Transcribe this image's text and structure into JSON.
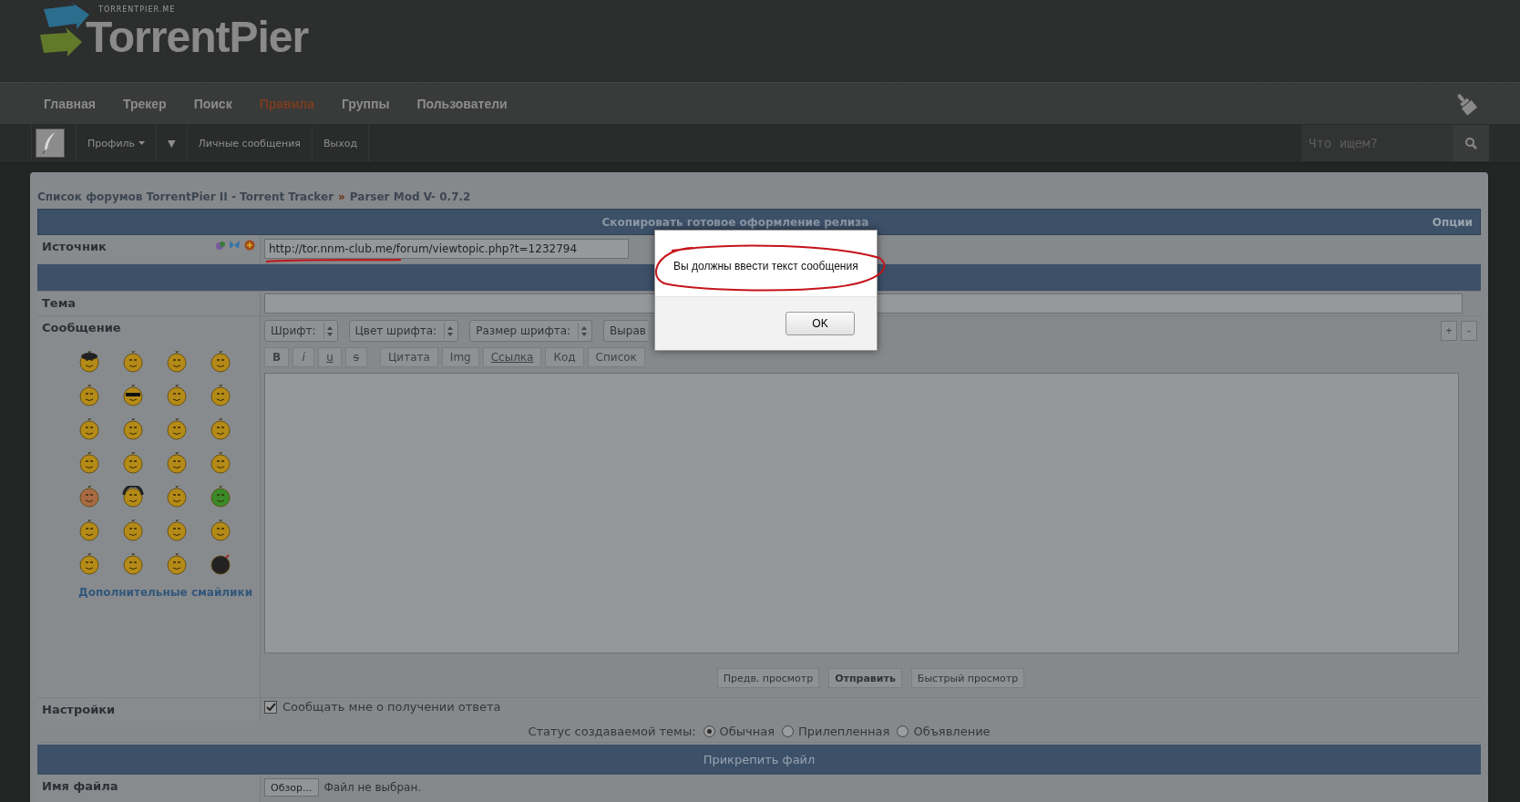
{
  "logo": {
    "title": "TorrentPier",
    "subtitle": "TORRENTPIER.ME"
  },
  "nav": [
    {
      "label": "Главная",
      "selected": false
    },
    {
      "label": "Трекер",
      "selected": false
    },
    {
      "label": "Поиск",
      "selected": false
    },
    {
      "label": "Правила",
      "selected": true
    },
    {
      "label": "Группы",
      "selected": false
    },
    {
      "label": "Пользователи",
      "selected": false
    }
  ],
  "userbar": {
    "profile": "Профиль",
    "more": "▼",
    "links": [
      "Личные сообщения",
      "Выход"
    ],
    "search": {
      "placeholder": "Что ищем?"
    }
  },
  "breadcrumb": {
    "items": [
      "Список форумов TorrentPier II - Torrent Tracker",
      "Parser Mod V- 0.7.2"
    ],
    "separator": "»"
  },
  "form": {
    "title": "Скопировать готовое оформление релиза",
    "options": "Опции",
    "source": {
      "label": "Источник",
      "value": "http://tor.nnm-club.me/forum/viewtopic.php?t=1232794"
    },
    "subject": {
      "label": "Тема"
    },
    "message": {
      "label": "Сообщение",
      "selects": [
        {
          "label": "Шрифт:",
          "cut": false
        },
        {
          "label": "Цвет шрифта:",
          "cut": false
        },
        {
          "label": "Размер шрифта:",
          "cut": false
        },
        {
          "label": "Вырав",
          "cut": true
        }
      ],
      "format_buttons": [
        {
          "label": "B",
          "kind": "bold"
        },
        {
          "label": "i",
          "kind": "italic"
        },
        {
          "label": "u",
          "kind": "underline"
        },
        {
          "label": "s",
          "kind": "strike"
        },
        {
          "label": "Цитата",
          "kind": "plain"
        },
        {
          "label": "Img",
          "kind": "plain"
        },
        {
          "label": "Ссылка",
          "kind": "underline"
        },
        {
          "label": "Код",
          "kind": "plain"
        },
        {
          "label": "Список",
          "kind": "plain"
        }
      ],
      "resize": [
        "+",
        "-"
      ],
      "more_smilies": "Дополнительные смайлики",
      "actions": [
        {
          "label": "Предв. просмотр",
          "primary": false
        },
        {
          "label": "Отправить",
          "primary": true
        },
        {
          "label": "Быстрый просмотр",
          "primary": false
        }
      ]
    },
    "settings": {
      "label": "Настройки",
      "notify": {
        "label": "Сообщать мне о получении ответа",
        "checked": true
      }
    },
    "status": {
      "label": "Статус создаваемой темы:",
      "options": [
        {
          "label": "Обычная",
          "selected": true
        },
        {
          "label": "Прилепленная",
          "selected": false
        },
        {
          "label": "Объявление",
          "selected": false
        }
      ]
    },
    "attach": {
      "title": "Прикрепить файл",
      "file_label": "Имя файла",
      "browse": "Обзор...",
      "no_file": "Файл не выбран."
    }
  },
  "dialog": {
    "message": "Вы должны ввести текст сообщения",
    "ok": "OK"
  }
}
